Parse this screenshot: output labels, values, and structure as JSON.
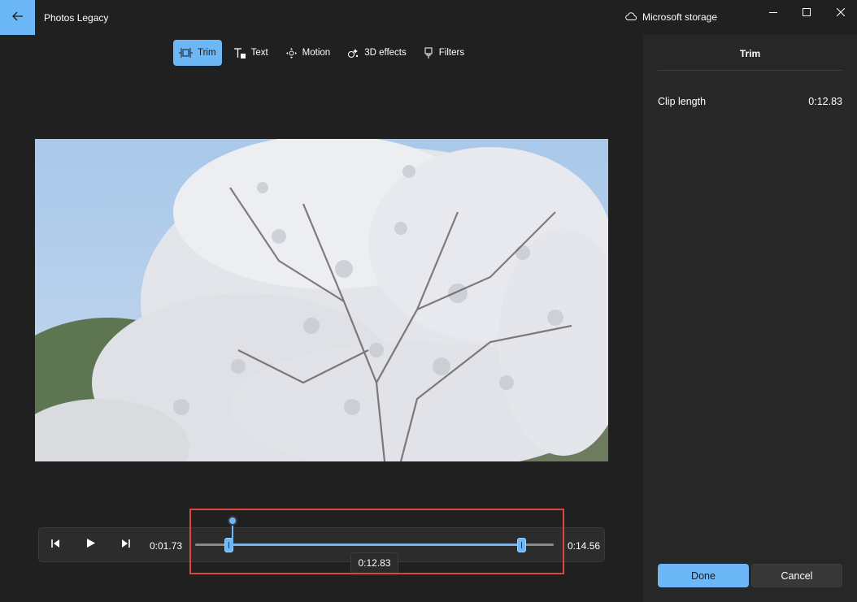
{
  "app": {
    "title": "Photos Legacy",
    "storage_label": "Microsoft storage"
  },
  "toolbar": {
    "items": [
      {
        "label": "Trim",
        "icon": "trim-icon",
        "active": true
      },
      {
        "label": "Text",
        "icon": "text-icon",
        "active": false
      },
      {
        "label": "Motion",
        "icon": "motion-icon",
        "active": false
      },
      {
        "label": "3D effects",
        "icon": "3d-effects-icon",
        "active": false
      },
      {
        "label": "Filters",
        "icon": "filters-icon",
        "active": false
      }
    ]
  },
  "player": {
    "start_time": "0:01.73",
    "end_time": "0:14.56",
    "tooltip": "0:12.83",
    "trim_start_fraction": 0.094,
    "trim_end_fraction": 0.909,
    "playhead_fraction": 0.105
  },
  "panel": {
    "title": "Trim",
    "clip_length_label": "Clip length",
    "clip_length_value": "0:12.83",
    "done_label": "Done",
    "cancel_label": "Cancel"
  },
  "colors": {
    "accent": "#6cb8f6",
    "background": "#202020",
    "panel": "#272727",
    "highlight": "#e0453c"
  }
}
